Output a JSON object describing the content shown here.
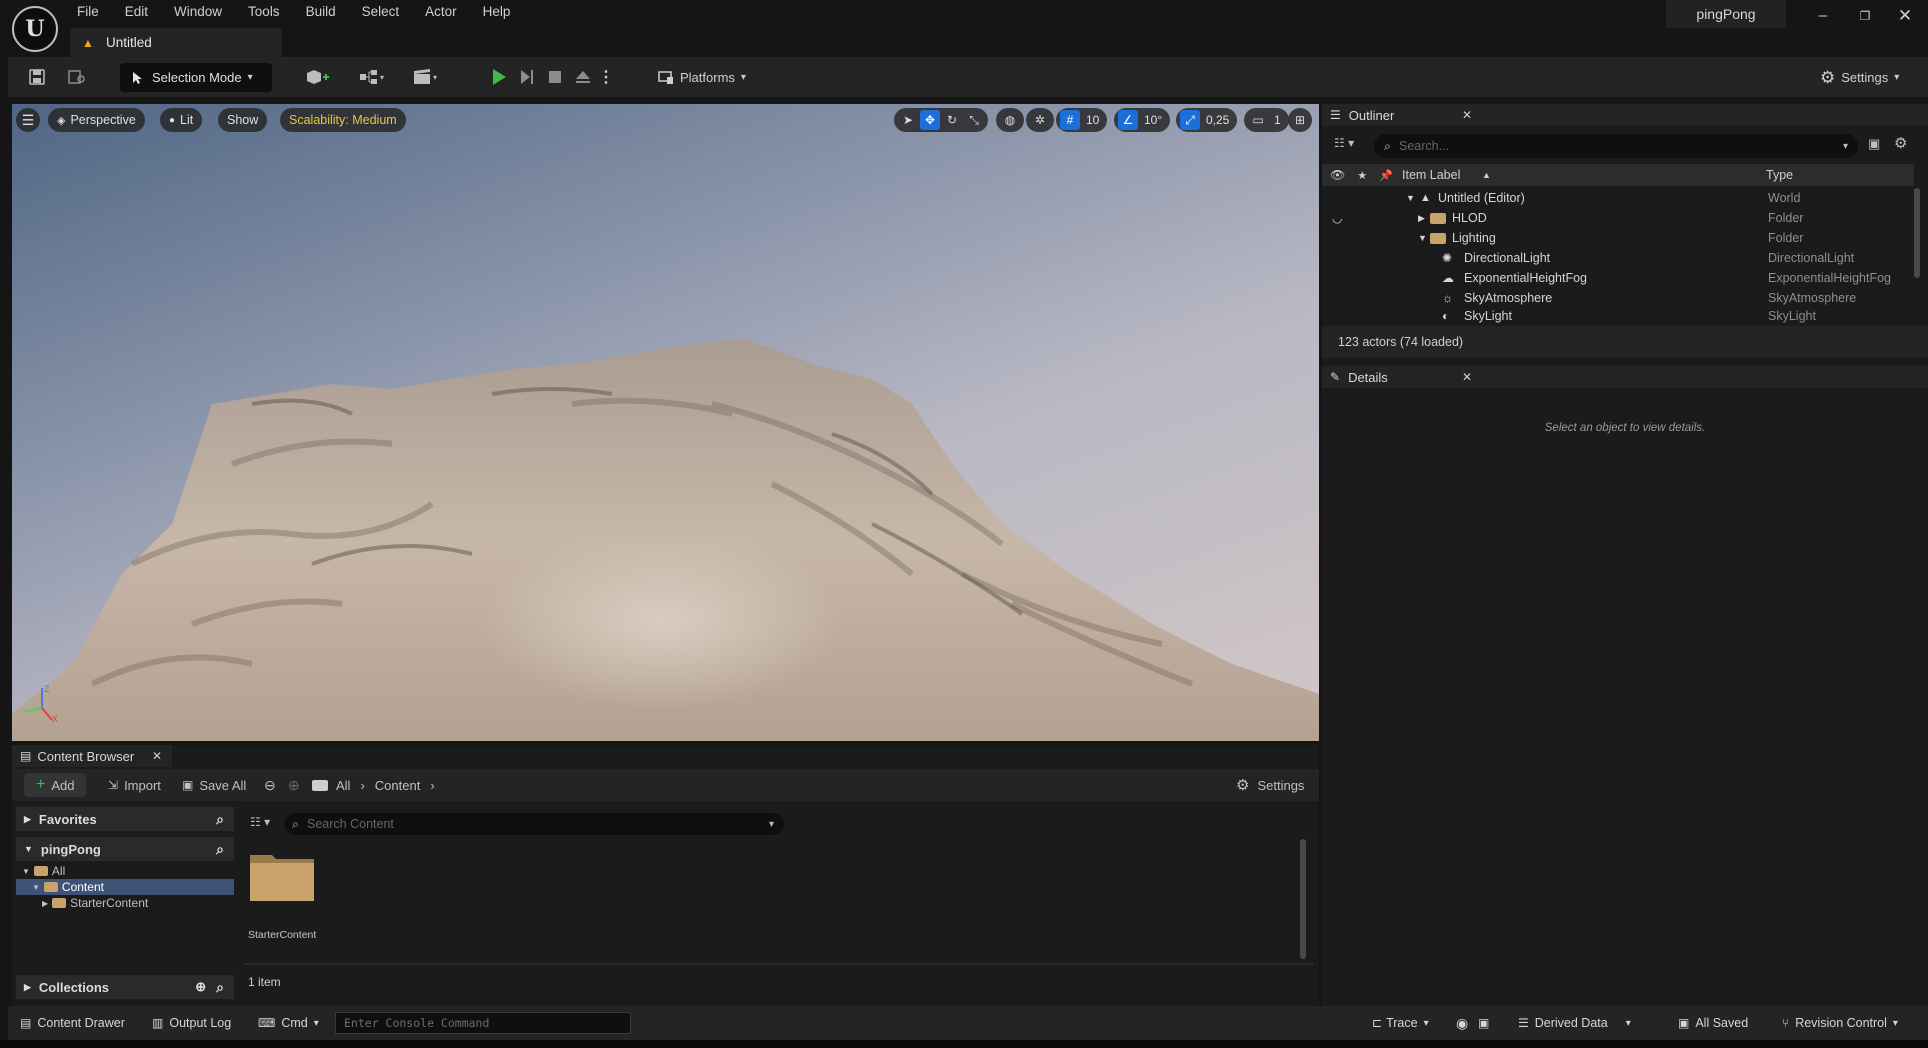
{
  "app": {
    "menu": [
      "File",
      "Edit",
      "Window",
      "Tools",
      "Build",
      "Select",
      "Actor",
      "Help"
    ],
    "doc_tab": "Untitled",
    "project_name": "pingPong"
  },
  "toolbar": {
    "selection_mode": "Selection Mode",
    "platforms": "Platforms",
    "settings": "Settings"
  },
  "viewport": {
    "perspective": "Perspective",
    "lit": "Lit",
    "show": "Show",
    "scalability": "Scalability: Medium",
    "grid_snap": "10",
    "rotation_snap": "10°",
    "scale_snap": "0,25",
    "camera_speed": "1",
    "axis_labels": {
      "z": "Z",
      "x": "X"
    }
  },
  "outliner": {
    "title": "Outliner",
    "search_placeholder": "Search...",
    "col_label": "Item Label",
    "col_type": "Type",
    "rows": [
      {
        "label": "Untitled (Editor)",
        "type": "World"
      },
      {
        "label": "HLOD",
        "type": "Folder"
      },
      {
        "label": "Lighting",
        "type": "Folder"
      },
      {
        "label": "DirectionalLight",
        "type": "DirectionalLight"
      },
      {
        "label": "ExponentialHeightFog",
        "type": "ExponentialHeightFog"
      },
      {
        "label": "SkyAtmosphere",
        "type": "SkyAtmosphere"
      },
      {
        "label": "SkyLight",
        "type": "SkyLight"
      }
    ],
    "status": "123 actors (74 loaded)"
  },
  "details": {
    "title": "Details",
    "empty_message": "Select an object to view details."
  },
  "content_browser": {
    "title": "Content Browser",
    "add": "Add",
    "import": "Import",
    "save_all": "Save All",
    "breadcrumb": [
      "All",
      "Content"
    ],
    "settings": "Settings",
    "favorites": "Favorites",
    "project": "pingPong",
    "tree": [
      "All",
      "Content",
      "StarterContent"
    ],
    "collections": "Collections",
    "search_placeholder": "Search Content",
    "asset_label": "StarterContent",
    "item_count": "1 item"
  },
  "statusbar": {
    "content_drawer": "Content Drawer",
    "output_log": "Output Log",
    "cmd": "Cmd",
    "console_placeholder": "Enter Console Command",
    "trace": "Trace",
    "derived_data": "Derived Data",
    "all_saved": "All Saved",
    "revision_control": "Revision Control"
  },
  "colors": {
    "accent_blue": "#1c6fd8",
    "play_green": "#3fb94a",
    "scalability_text": "#e8c64a",
    "warning": "#f0a61c",
    "folder": "#c9a36a"
  }
}
